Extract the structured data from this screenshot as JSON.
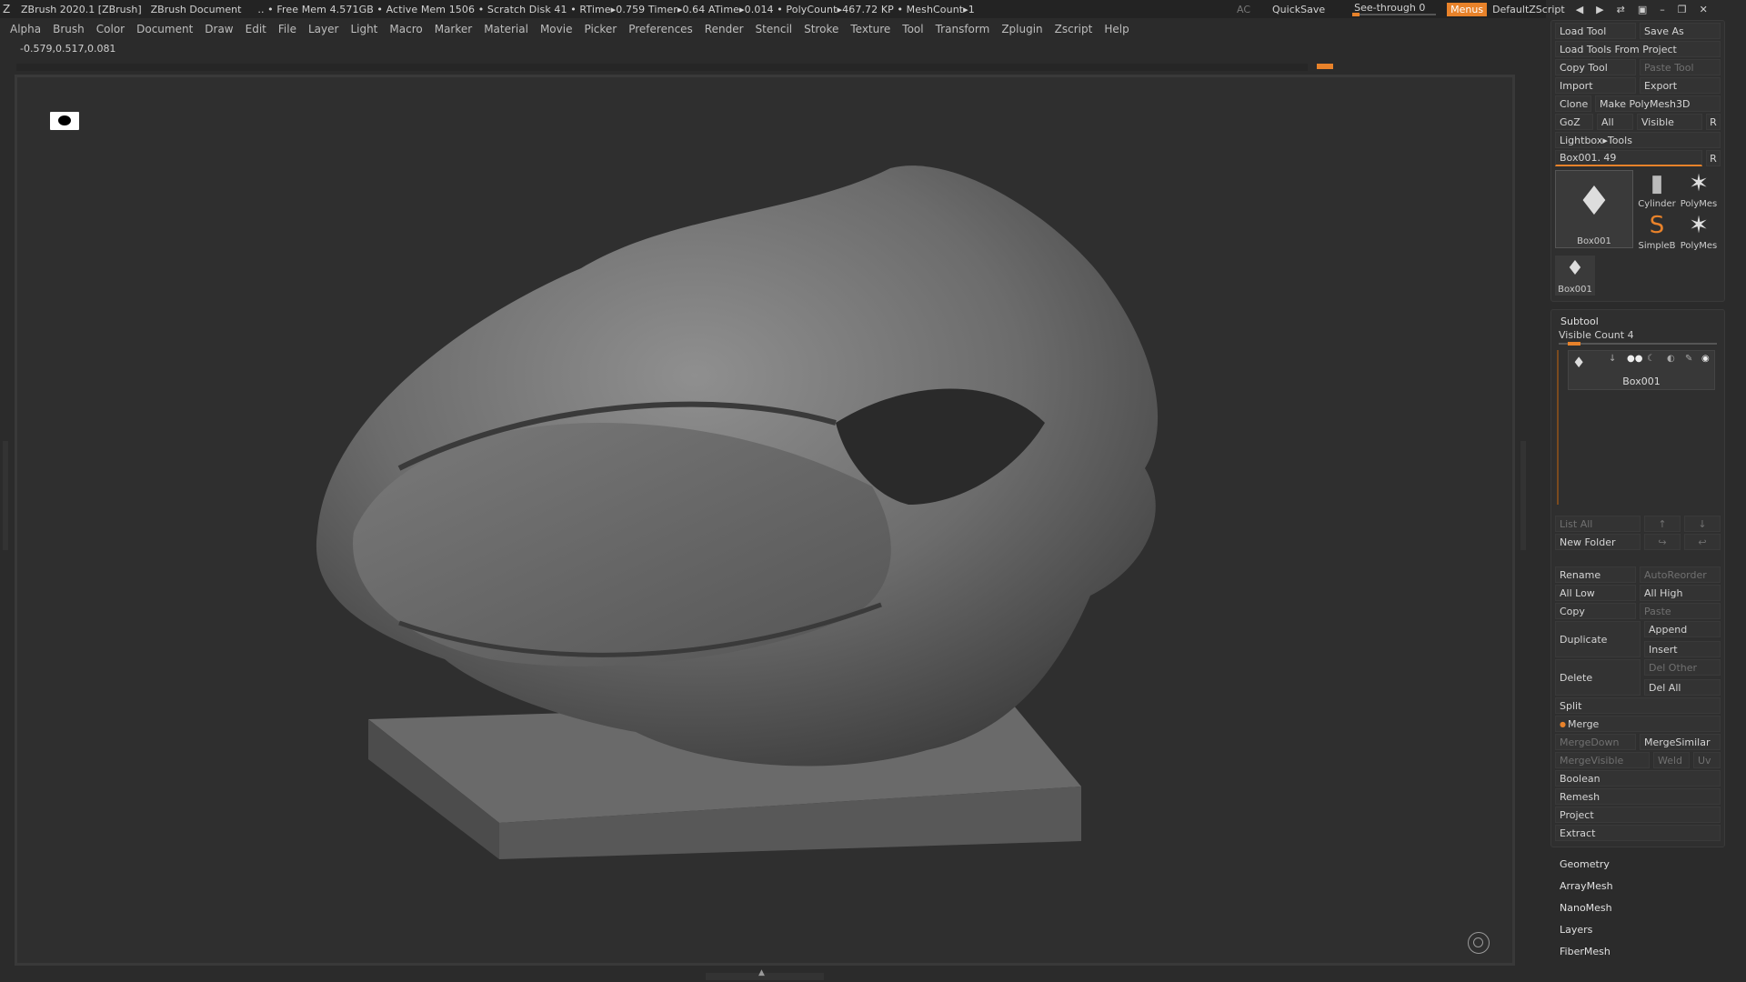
{
  "titlebar": {
    "app": "ZBrush 2020.1 [ZBrush]",
    "document": "ZBrush Document",
    "stats": ".. • Free Mem 4.571GB • Active Mem 1506 • Scratch Disk 41 •  RTime▸0.759 Timer▸0.64 ATime▸0.014 • PolyCount▸467.72 KP  • MeshCount▸1"
  },
  "topright": {
    "ac": "AC",
    "quicksave": "QuickSave",
    "see_through": "See-through  0",
    "menus": "Menus",
    "script": "DefaultZScript"
  },
  "menubar": [
    "Alpha",
    "Brush",
    "Color",
    "Document",
    "Draw",
    "Edit",
    "File",
    "Layer",
    "Light",
    "Macro",
    "Marker",
    "Material",
    "Movie",
    "Picker",
    "Preferences",
    "Render",
    "Stencil",
    "Stroke",
    "Texture",
    "Tool",
    "Transform",
    "Zplugin",
    "Zscript",
    "Help"
  ],
  "coords": "-0.579,0.517,0.081",
  "tool_panel": {
    "load_tool": "Load Tool",
    "save_as": "Save As",
    "load_tools_from_project": "Load Tools From Project",
    "copy_tool": "Copy Tool",
    "paste_tool": "Paste Tool",
    "import": "Import",
    "export": "Export",
    "clone": "Clone",
    "make_polymesh": "Make PolyMesh3D",
    "goz": "GoZ",
    "all": "All",
    "visible": "Visible",
    "r": "R",
    "lightbox_tools": "Lightbox▸Tools",
    "tool_slider": "Box001. 49",
    "thumbs": {
      "big": "Box001",
      "cylinder": "Cylinder",
      "polymesh1": "PolyMes",
      "simpleb": "SimpleB",
      "polymesh2": "PolyMes",
      "small": "Box001"
    }
  },
  "subtool": {
    "header": "Subtool",
    "visible_count": "Visible Count 4",
    "item_name": "Box001",
    "list_all": "List All",
    "new_folder": "New Folder",
    "rename": "Rename",
    "autoreorder": "AutoReorder",
    "all_low": "All Low",
    "all_high": "All High",
    "copy": "Copy",
    "paste": "Paste",
    "duplicate": "Duplicate",
    "append": "Append",
    "insert": "Insert",
    "delete": "Delete",
    "del_other": "Del Other",
    "del_all": "Del All",
    "split": "Split",
    "merge": "Merge",
    "mergedown": "MergeDown",
    "mergesimilar": "MergeSimilar",
    "mergevisible": "MergeVisible",
    "weld": "Weld",
    "uv": "Uv",
    "boolean": "Boolean",
    "remesh": "Remesh",
    "project": "Project",
    "extract": "Extract"
  },
  "tool_sections": [
    "Geometry",
    "ArrayMesh",
    "NanoMesh",
    "Layers",
    "FiberMesh"
  ],
  "colors": {
    "accent": "#e8822a",
    "bg": "#2b2b2b"
  }
}
